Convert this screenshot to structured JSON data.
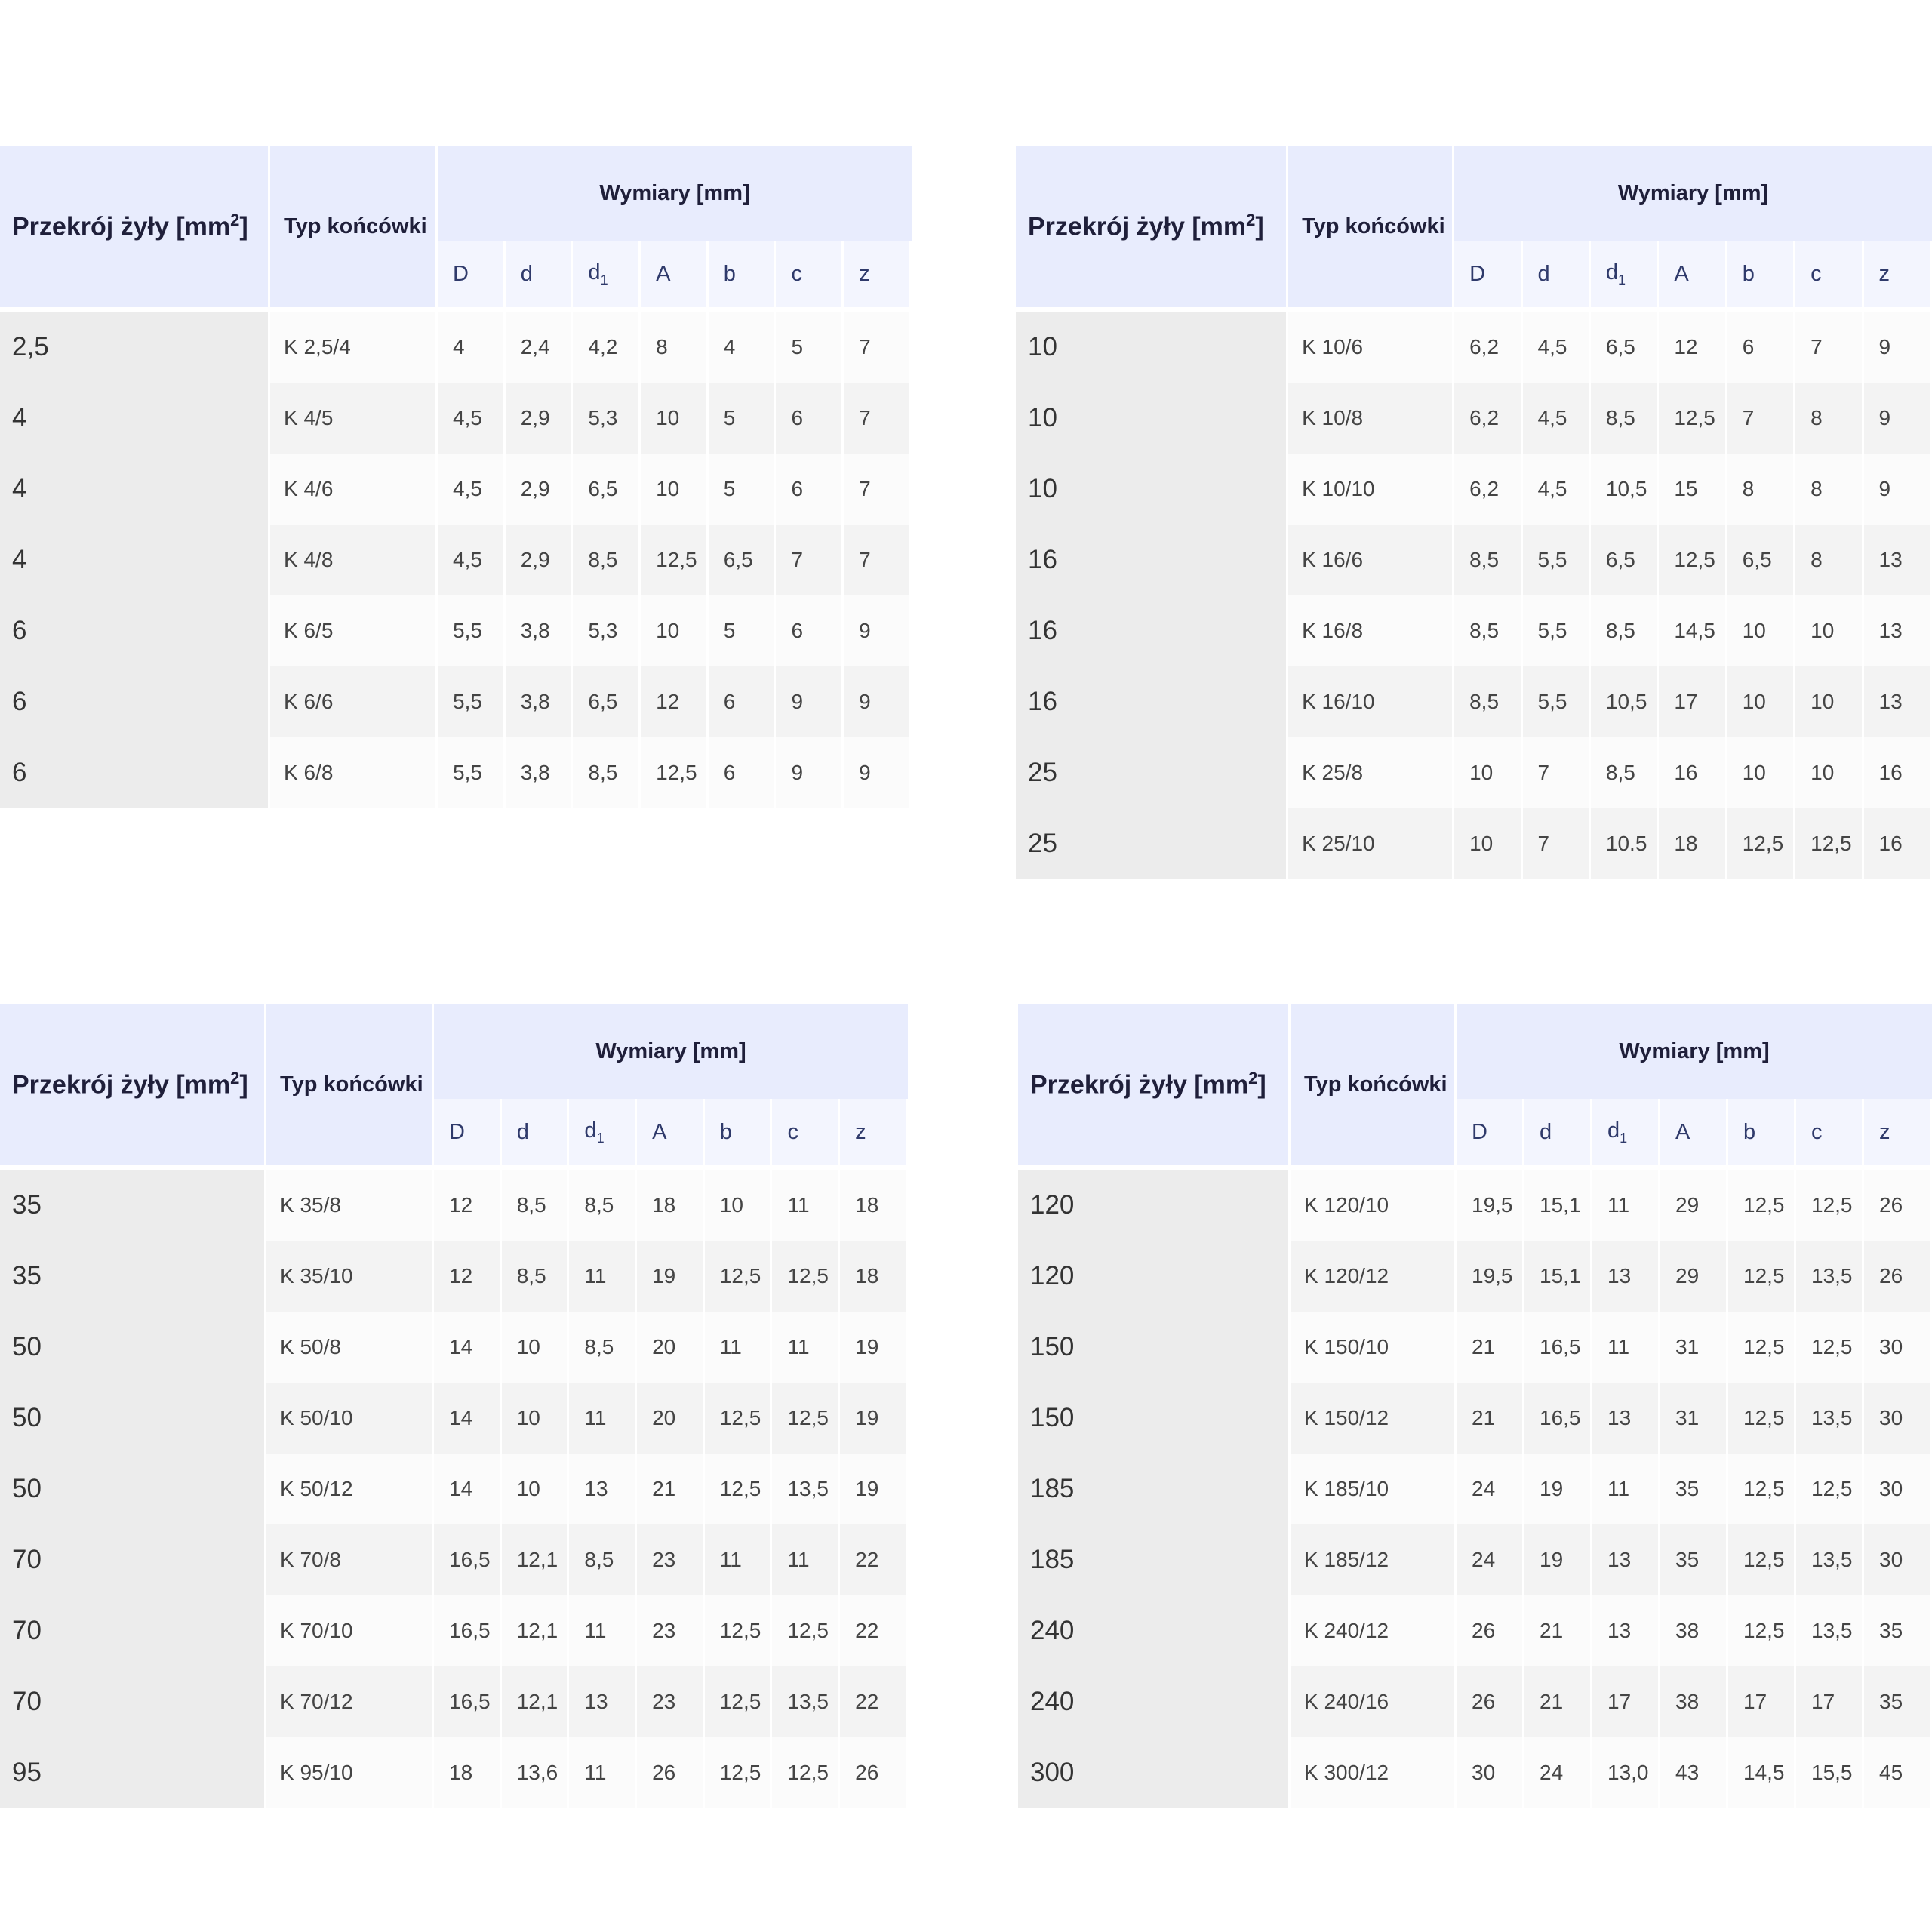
{
  "header": {
    "przekroj": "Przekrój żyły [mm",
    "przekroj_sup": "2",
    "przekroj_end": "]",
    "typ": "Typ końcówki",
    "wymiary": "Wymiary [mm]",
    "cols": [
      "D",
      "d",
      "d",
      "A",
      "b",
      "c",
      "z"
    ],
    "d1_sub": "1"
  },
  "tables": [
    {
      "rows": [
        [
          "2,5",
          "K 2,5/4",
          "4",
          "2,4",
          "4,2",
          "8",
          "4",
          "5",
          "7"
        ],
        [
          "4",
          "K 4/5",
          "4,5",
          "2,9",
          "5,3",
          "10",
          "5",
          "6",
          "7"
        ],
        [
          "4",
          "K 4/6",
          "4,5",
          "2,9",
          "6,5",
          "10",
          "5",
          "6",
          "7"
        ],
        [
          "4",
          "K 4/8",
          "4,5",
          "2,9",
          "8,5",
          "12,5",
          "6,5",
          "7",
          "7"
        ],
        [
          "6",
          "K 6/5",
          "5,5",
          "3,8",
          "5,3",
          "10",
          "5",
          "6",
          "9"
        ],
        [
          "6",
          "K 6/6",
          "5,5",
          "3,8",
          "6,5",
          "12",
          "6",
          "9",
          "9"
        ],
        [
          "6",
          "K 6/8",
          "5,5",
          "3,8",
          "8,5",
          "12,5",
          "6",
          "9",
          "9"
        ]
      ]
    },
    {
      "rows": [
        [
          "10",
          "K 10/6",
          "6,2",
          "4,5",
          "6,5",
          "12",
          "6",
          "7",
          "9"
        ],
        [
          "10",
          "K 10/8",
          "6,2",
          "4,5",
          "8,5",
          "12,5",
          "7",
          "8",
          "9"
        ],
        [
          "10",
          "K 10/10",
          "6,2",
          "4,5",
          "10,5",
          "15",
          "8",
          "8",
          "9"
        ],
        [
          "16",
          "K 16/6",
          "8,5",
          "5,5",
          "6,5",
          "12,5",
          "6,5",
          "8",
          "13"
        ],
        [
          "16",
          "K 16/8",
          "8,5",
          "5,5",
          "8,5",
          "14,5",
          "10",
          "10",
          "13"
        ],
        [
          "16",
          "K 16/10",
          "8,5",
          "5,5",
          "10,5",
          "17",
          "10",
          "10",
          "13"
        ],
        [
          "25",
          "K 25/8",
          "10",
          "7",
          "8,5",
          "16",
          "10",
          "10",
          "16"
        ],
        [
          "25",
          "K 25/10",
          "10",
          "7",
          "10.5",
          "18",
          "12,5",
          "12,5",
          "16"
        ]
      ]
    },
    {
      "rows": [
        [
          "35",
          "K 35/8",
          "12",
          "8,5",
          "8,5",
          "18",
          "10",
          "11",
          "18"
        ],
        [
          "35",
          "K 35/10",
          "12",
          "8,5",
          "11",
          "19",
          "12,5",
          "12,5",
          "18"
        ],
        [
          "50",
          "K 50/8",
          "14",
          "10",
          "8,5",
          "20",
          "11",
          "11",
          "19"
        ],
        [
          "50",
          "K 50/10",
          "14",
          "10",
          "11",
          "20",
          "12,5",
          "12,5",
          "19"
        ],
        [
          "50",
          "K 50/12",
          "14",
          "10",
          "13",
          "21",
          "12,5",
          "13,5",
          "19"
        ],
        [
          "70",
          "K 70/8",
          "16,5",
          "12,1",
          "8,5",
          "23",
          "11",
          "11",
          "22"
        ],
        [
          "70",
          "K 70/10",
          "16,5",
          "12,1",
          "11",
          "23",
          "12,5",
          "12,5",
          "22"
        ],
        [
          "70",
          "K 70/12",
          "16,5",
          "12,1",
          "13",
          "23",
          "12,5",
          "13,5",
          "22"
        ],
        [
          "95",
          "K 95/10",
          "18",
          "13,6",
          "11",
          "26",
          "12,5",
          "12,5",
          "26"
        ]
      ]
    },
    {
      "rows": [
        [
          "120",
          "K 120/10",
          "19,5",
          "15,1",
          "11",
          "29",
          "12,5",
          "12,5",
          "26"
        ],
        [
          "120",
          "K 120/12",
          "19,5",
          "15,1",
          "13",
          "29",
          "12,5",
          "13,5",
          "26"
        ],
        [
          "150",
          "K 150/10",
          "21",
          "16,5",
          "11",
          "31",
          "12,5",
          "12,5",
          "30"
        ],
        [
          "150",
          "K 150/12",
          "21",
          "16,5",
          "13",
          "31",
          "12,5",
          "13,5",
          "30"
        ],
        [
          "185",
          "K 185/10",
          "24",
          "19",
          "11",
          "35",
          "12,5",
          "12,5",
          "30"
        ],
        [
          "185",
          "K 185/12",
          "24",
          "19",
          "13",
          "35",
          "12,5",
          "13,5",
          "30"
        ],
        [
          "240",
          "K 240/12",
          "26",
          "21",
          "13",
          "38",
          "12,5",
          "13,5",
          "35"
        ],
        [
          "240",
          "K 240/16",
          "26",
          "21",
          "17",
          "38",
          "17",
          "17",
          "35"
        ],
        [
          "300",
          "K 300/12",
          "30",
          "24",
          "13,0",
          "43",
          "14,5",
          "15,5",
          "45"
        ]
      ]
    }
  ]
}
